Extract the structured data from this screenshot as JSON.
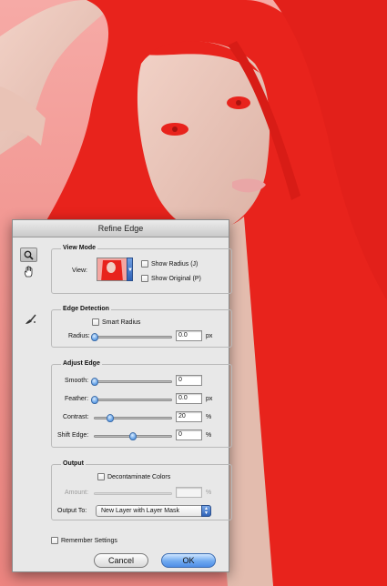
{
  "dialog": {
    "title": "Refine Edge",
    "view_mode": {
      "title": "View Mode",
      "view_label": "View:",
      "show_radius": "Show Radius (J)",
      "show_original": "Show Original (P)"
    },
    "edge_detection": {
      "title": "Edge Detection",
      "smart_radius": "Smart Radius",
      "radius_label": "Radius:",
      "radius_value": "0.0",
      "radius_unit": "px"
    },
    "adjust_edge": {
      "title": "Adjust Edge",
      "smooth_label": "Smooth:",
      "smooth_value": "0",
      "feather_label": "Feather:",
      "feather_value": "0.0",
      "feather_unit": "px",
      "contrast_label": "Contrast:",
      "contrast_value": "20",
      "contrast_unit": "%",
      "shift_label": "Shift Edge:",
      "shift_value": "0",
      "shift_unit": "%"
    },
    "output": {
      "title": "Output",
      "decontaminate": "Decontaminate Colors",
      "amount_label": "Amount:",
      "amount_value": "",
      "amount_unit": "%",
      "output_to_label": "Output To:",
      "output_to_value": "New Layer with Layer Mask"
    },
    "remember": "Remember Settings",
    "cancel": "Cancel",
    "ok": "OK"
  },
  "colors": {
    "mask_overlay": "#e8231c",
    "background": "#f3a19c",
    "accent": "#4f8ee6"
  }
}
